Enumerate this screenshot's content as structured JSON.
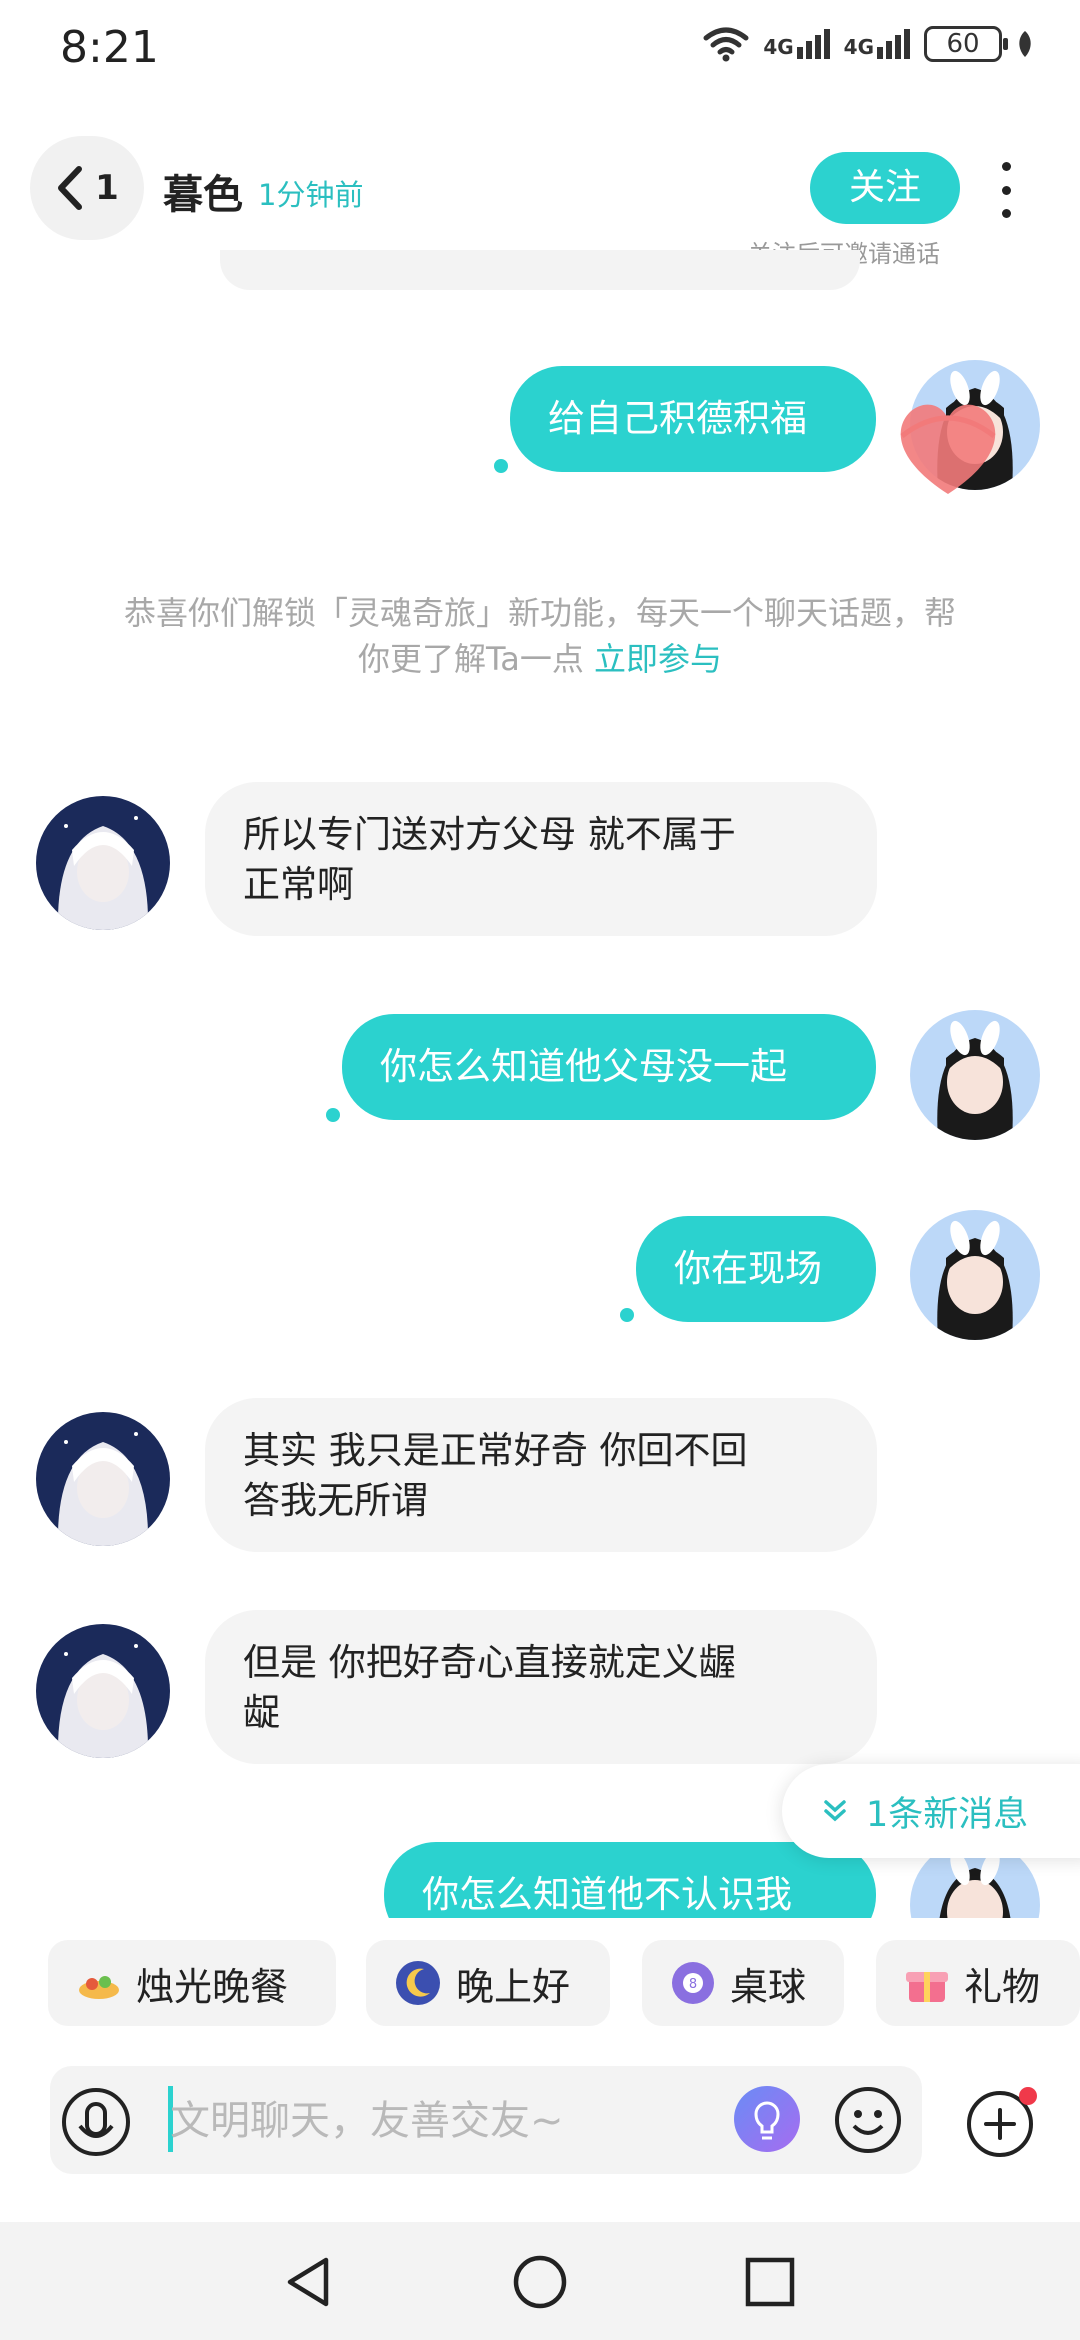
{
  "status_bar": {
    "time": "8:21",
    "network1": "4G",
    "network2": "4G",
    "battery": "60"
  },
  "header": {
    "back_count": "1",
    "name": "暮色",
    "last_active": "1分钟前",
    "follow_label": "关注",
    "follow_hint": "关注后可邀请通话"
  },
  "messages": {
    "m1": "给自己积德积福",
    "system_note": "恭喜你们解锁「灵魂奇旅」新功能，每天一个聊天话题，帮你更了解Ta一点",
    "system_link": "立即参与",
    "m2_line1": "所以专门送对方父母  就不属于",
    "m2_line2": "正常啊",
    "m3": "你怎么知道他父母没一起",
    "m4": "你在现场",
    "m5_line1": "其实  我只是正常好奇  你回不回",
    "m5_line2": "答我无所谓",
    "m6_line1": "但是  你把好奇心直接就定义龌",
    "m6_line2": "龊",
    "m7": "你怎么知道他不认识我"
  },
  "new_message_label": "1条新消息",
  "quick_chips": [
    "烛光晚餐",
    "晚上好",
    "桌球",
    "礼物"
  ],
  "input": {
    "placeholder": "文明聊天，友善交友~"
  },
  "colors": {
    "accent": "#2bd2cf",
    "accent_text": "#2bbfc0",
    "incoming_bubble": "#f4f4f4"
  }
}
